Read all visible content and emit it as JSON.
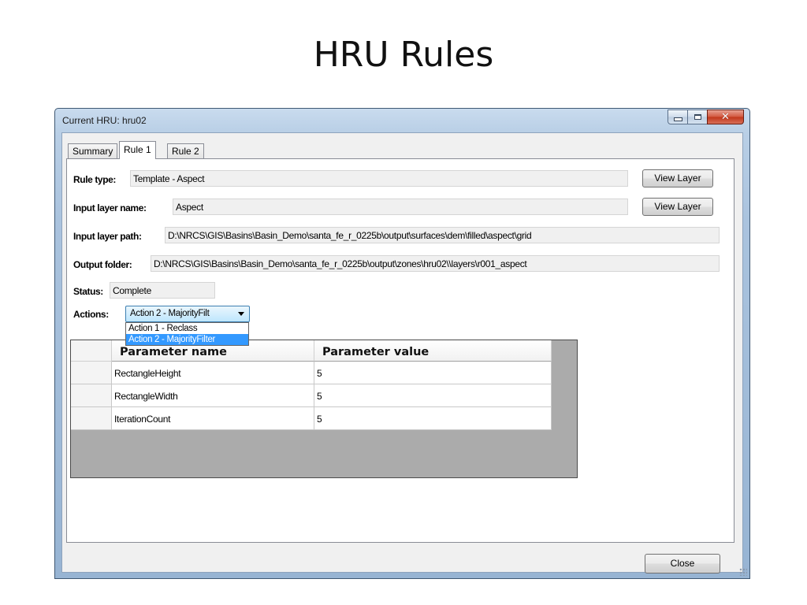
{
  "slide": {
    "title": "HRU Rules"
  },
  "window": {
    "title": "Current HRU: hru02",
    "close_glyph": "✕"
  },
  "tabs": [
    {
      "label": "Summary"
    },
    {
      "label": "Rule 1"
    },
    {
      "label": "Rule 2"
    }
  ],
  "rule": {
    "rule_type_label": "Rule type:",
    "rule_type_value": "Template - Aspect",
    "input_layer_name_label": "Input layer name:",
    "input_layer_name_value": "Aspect",
    "input_layer_path_label": "Input layer path:",
    "input_layer_path_value": "D:\\NRCS\\GIS\\Basins\\Basin_Demo\\santa_fe_r_0225b\\output\\surfaces\\dem\\filled\\aspect\\grid",
    "output_folder_label": "Output folder:",
    "output_folder_value": "D:\\NRCS\\GIS\\Basins\\Basin_Demo\\santa_fe_r_0225b\\output\\zones\\hru02\\\\layers\\r001_aspect",
    "status_label": "Status:",
    "status_value": "Complete",
    "actions_label": "Actions:",
    "actions_selected": "Action 2 - MajorityFilt",
    "view_layer_label": "View Layer"
  },
  "dropdown_options": [
    {
      "label": "Action 1 - Reclass"
    },
    {
      "label": "Action 2 - MajorityFilter"
    }
  ],
  "grid": {
    "headers": {
      "name": "Parameter name",
      "value": "Parameter value"
    },
    "rows": [
      {
        "name": "RectangleHeight",
        "value": "5"
      },
      {
        "name": "RectangleWidth",
        "value": "5"
      },
      {
        "name": "IterationCount",
        "value": "5"
      }
    ]
  },
  "footer": {
    "close_label": "Close"
  }
}
